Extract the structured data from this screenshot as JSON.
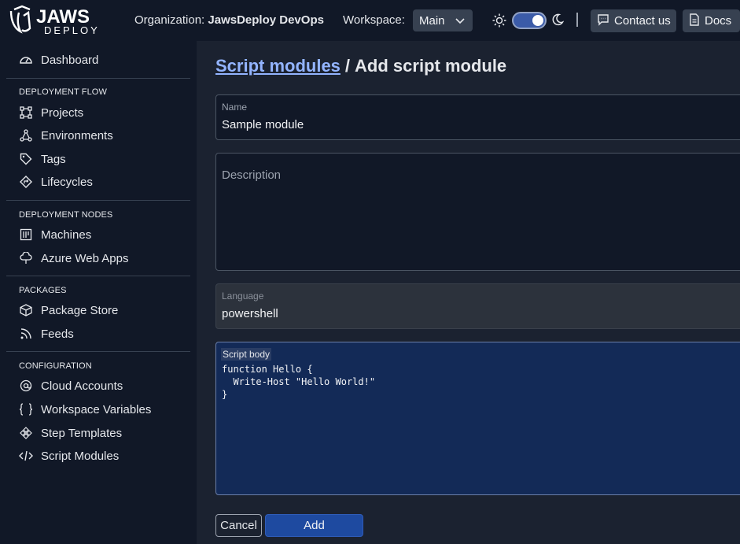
{
  "brand": {
    "logo_text": "JAWS",
    "logo_sub": "DEPLOY"
  },
  "header": {
    "org_label": "Organization:",
    "org_name": "JawsDeploy DevOps",
    "workspace_label": "Workspace:",
    "workspace_value": "Main",
    "contact_label": "Contact us",
    "docs_label": "Docs",
    "theme_toggle_on": true
  },
  "sidebar": {
    "dashboard": "Dashboard",
    "sections": {
      "flow": "DEPLOYMENT FLOW",
      "nodes": "DEPLOYMENT NODES",
      "packages": "PACKAGES",
      "config": "CONFIGURATION"
    },
    "items": {
      "projects": "Projects",
      "environments": "Environments",
      "tags": "Tags",
      "lifecycles": "Lifecycles",
      "machines": "Machines",
      "azure": "Azure Web Apps",
      "package_store": "Package Store",
      "feeds": "Feeds",
      "cloud_accounts": "Cloud Accounts",
      "workspace_variables": "Workspace Variables",
      "step_templates": "Step Templates",
      "script_modules": "Script Modules"
    }
  },
  "main": {
    "breadcrumb_link": "Script modules",
    "breadcrumb_sep": "/",
    "breadcrumb_current": "Add script module",
    "name_label": "Name",
    "name_value": "Sample module",
    "description_placeholder": "Description",
    "language_label": "Language",
    "language_value": "powershell",
    "script_label": "Script body",
    "script_body": "function Hello {\n  Write-Host \"Hello World!\"\n}",
    "cancel_label": "Cancel",
    "add_label": "Add"
  },
  "colors": {
    "background": "#111827",
    "main_bg": "#1b2230",
    "link": "#93b4ff",
    "primary_button": "#1e4aa0",
    "script_bg": "#132a57"
  }
}
